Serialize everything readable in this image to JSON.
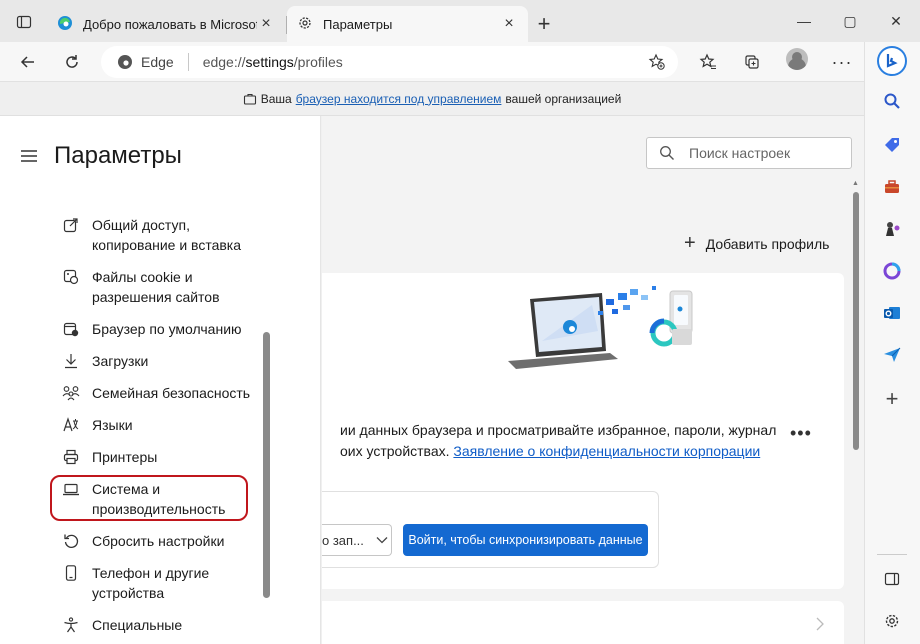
{
  "tabs": [
    {
      "title": "Добро пожаловать в Microsoft Edge",
      "active": false
    },
    {
      "title": "Параметры",
      "active": true
    }
  ],
  "new_tab_label": "+",
  "window_controls": {
    "minimize": "—",
    "maximize": "▢",
    "close": "✕"
  },
  "addressbar": {
    "site_label": "Edge",
    "url_scheme": "edge://",
    "url_host": "settings",
    "url_path": "/profiles"
  },
  "managed_banner": {
    "prefix": "Ваша",
    "link": "браузер находится под управлением",
    "suffix": "вашей организацией"
  },
  "settings": {
    "title": "Параметры",
    "search_placeholder": "Поиск настроек",
    "nav": [
      {
        "label_line1": "Общий доступ,",
        "label_line2": "копирование и вставка",
        "icon": "share-icon"
      },
      {
        "label_line1": "Файлы cookie и",
        "label_line2": "разрешения сайтов",
        "icon": "cookie-icon"
      },
      {
        "label_line1": "Браузер по умолчанию",
        "label_line2": "",
        "icon": "default-browser-icon"
      },
      {
        "label_line1": "Загрузки",
        "label_line2": "",
        "icon": "download-icon"
      },
      {
        "label_line1": "Семейная безопасность",
        "label_line2": "",
        "icon": "family-icon"
      },
      {
        "label_line1": "Языки",
        "label_line2": "",
        "icon": "language-icon"
      },
      {
        "label_line1": "Принтеры",
        "label_line2": "",
        "icon": "printer-icon"
      },
      {
        "label_line1": "Система и",
        "label_line2": "производительность",
        "icon": "laptop-icon"
      },
      {
        "label_line1": "Сбросить настройки",
        "label_line2": "",
        "icon": "reset-icon"
      },
      {
        "label_line1": "Телефон и другие",
        "label_line2": "устройства",
        "icon": "phone-icon"
      },
      {
        "label_line1": "Специальные",
        "label_line2": "",
        "icon": "accessibility-icon"
      }
    ],
    "highlighted_item": "Система и производительность"
  },
  "profiles": {
    "add_profile": "Добавить профиль",
    "sync_text_line1": "ии данных браузера и просматривайте избранное, пароли, журнал",
    "sync_text_line2_prefix": "оих устройствах.",
    "privacy_link": "Заявление о конфиденциальности корпорации",
    "more_label": "•••",
    "dropdown_value": "о зап...",
    "sync_button": "Войти, чтобы синхронизировать данные"
  },
  "colors": {
    "accent": "#1469d1",
    "highlight_border": "#c0161c",
    "link": "#0f5cc7"
  }
}
